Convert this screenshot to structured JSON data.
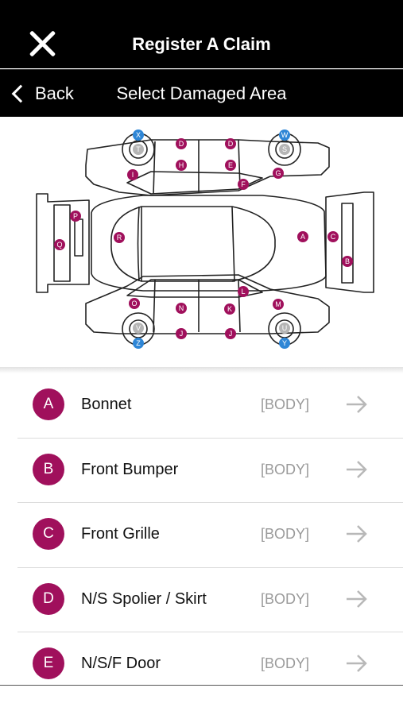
{
  "header": {
    "title": "Register A Claim",
    "close_icon": "close-icon"
  },
  "subheader": {
    "back_label": "Back",
    "title": "Select Damaged Area"
  },
  "colors": {
    "accent": "#a0105c",
    "wheel_marker": "#2e86d6",
    "bar": "#000000"
  },
  "diagram": {
    "markers": [
      {
        "id": "A",
        "color": "accent"
      },
      {
        "id": "B",
        "color": "accent"
      },
      {
        "id": "C",
        "color": "accent"
      },
      {
        "id": "D",
        "color": "accent"
      },
      {
        "id": "E",
        "color": "accent"
      },
      {
        "id": "F",
        "color": "accent"
      },
      {
        "id": "G",
        "color": "accent"
      },
      {
        "id": "H",
        "color": "accent"
      },
      {
        "id": "I",
        "color": "accent"
      },
      {
        "id": "J",
        "color": "accent"
      },
      {
        "id": "K",
        "color": "accent"
      },
      {
        "id": "L",
        "color": "accent"
      },
      {
        "id": "M",
        "color": "accent"
      },
      {
        "id": "N",
        "color": "accent"
      },
      {
        "id": "O",
        "color": "accent"
      },
      {
        "id": "P",
        "color": "accent"
      },
      {
        "id": "Q",
        "color": "accent"
      },
      {
        "id": "R",
        "color": "accent"
      },
      {
        "id": "S",
        "color": "grey"
      },
      {
        "id": "T",
        "color": "grey"
      },
      {
        "id": "U",
        "color": "grey"
      },
      {
        "id": "V",
        "color": "grey"
      },
      {
        "id": "W",
        "color": "blue"
      },
      {
        "id": "X",
        "color": "blue"
      },
      {
        "id": "Y",
        "color": "blue"
      },
      {
        "id": "Z",
        "color": "blue"
      }
    ]
  },
  "areas": [
    {
      "letter": "A",
      "label": "Bonnet",
      "category": "[BODY]"
    },
    {
      "letter": "B",
      "label": "Front Bumper",
      "category": "[BODY]"
    },
    {
      "letter": "C",
      "label": "Front Grille",
      "category": "[BODY]"
    },
    {
      "letter": "D",
      "label": "N/S Spolier / Skirt",
      "category": "[BODY]"
    },
    {
      "letter": "E",
      "label": "N/S/F Door",
      "category": "[BODY]"
    }
  ]
}
